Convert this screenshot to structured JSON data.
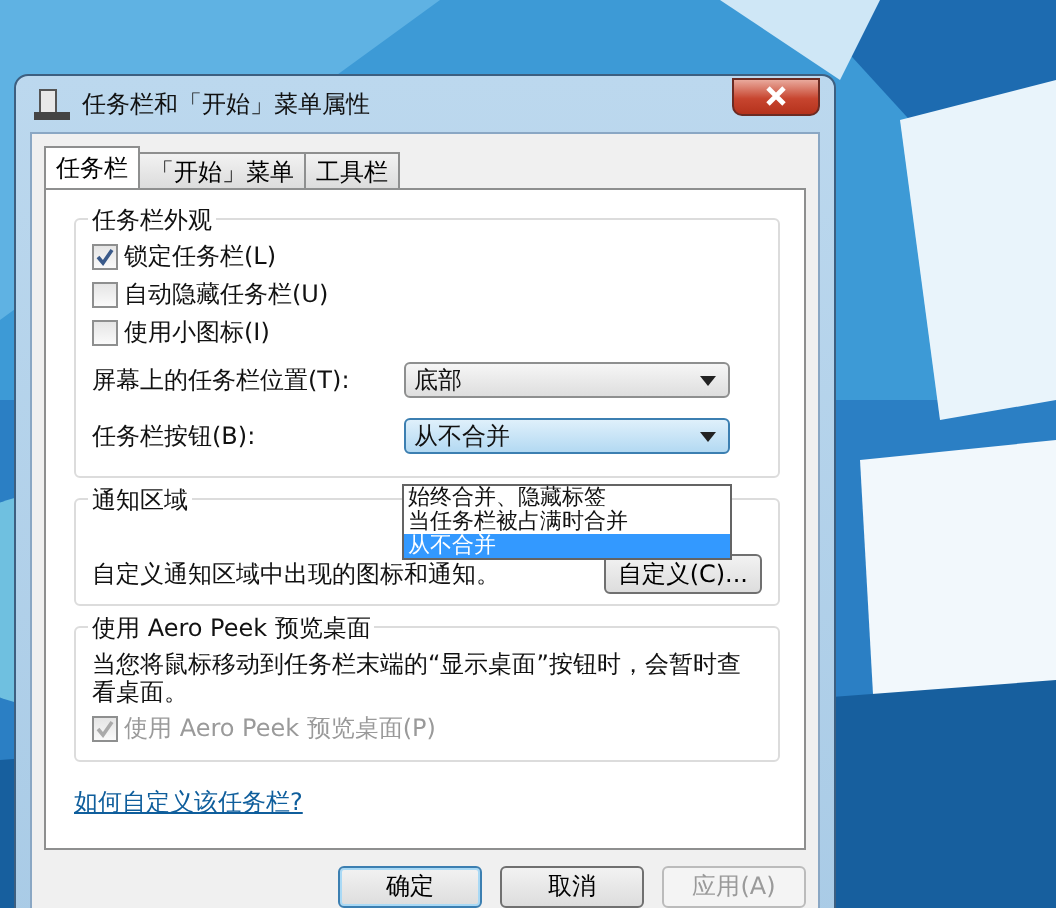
{
  "window": {
    "title": "任务栏和「开始」菜单属性"
  },
  "tabs": [
    {
      "label": "任务栏",
      "selected": true
    },
    {
      "label": "「开始」菜单",
      "selected": false
    },
    {
      "label": "工具栏",
      "selected": false
    }
  ],
  "appearance": {
    "title": "任务栏外观",
    "checkboxes": [
      {
        "label": "锁定任务栏(L)",
        "checked": true
      },
      {
        "label": "自动隐藏任务栏(U)",
        "checked": false
      },
      {
        "label": "使用小图标(I)",
        "checked": false
      }
    ],
    "selects": [
      {
        "label": "屏幕上的任务栏位置(T):",
        "value": "底部",
        "expanded": false
      },
      {
        "label": "任务栏按钮(B):",
        "value": "从不合并",
        "expanded": true
      }
    ],
    "dropdown_options": [
      {
        "label": "始终合并、隐藏标签",
        "selected": false
      },
      {
        "label": "当任务栏被占满时合并",
        "selected": false
      },
      {
        "label": "从不合并",
        "selected": true
      }
    ]
  },
  "notification": {
    "title": "通知区域",
    "text": "自定义通知区域中出现的图标和通知。",
    "button": "自定义(C)..."
  },
  "aero_peek": {
    "title": "使用 Aero Peek 预览桌面",
    "text": "当您将鼠标移动到任务栏末端的“显示桌面”按钮时，会暂时查看桌面。",
    "checkbox": {
      "label": "使用 Aero Peek 预览桌面(P)",
      "checked": true,
      "disabled": true
    }
  },
  "link": "如何自定义该任务栏?",
  "buttons": [
    {
      "label": "确定",
      "default": true,
      "disabled": false
    },
    {
      "label": "取消",
      "default": false,
      "disabled": false
    },
    {
      "label": "应用(A)",
      "default": false,
      "disabled": true
    }
  ]
}
